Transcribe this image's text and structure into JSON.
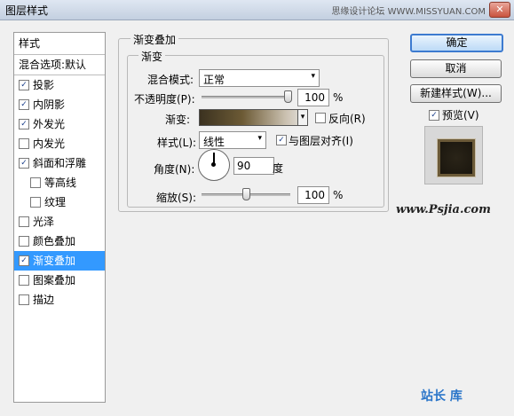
{
  "window": {
    "title": "图层样式",
    "watermark": "思缘设计论坛 WWW.MISSYUAN.COM",
    "close_glyph": "✕"
  },
  "styles_panel": {
    "header": "样式",
    "blend_default": "混合选项:默认",
    "items": [
      {
        "label": "投影",
        "checked": true,
        "sub": false,
        "selected": false
      },
      {
        "label": "内阴影",
        "checked": true,
        "sub": false,
        "selected": false
      },
      {
        "label": "外发光",
        "checked": true,
        "sub": false,
        "selected": false
      },
      {
        "label": "内发光",
        "checked": false,
        "sub": false,
        "selected": false
      },
      {
        "label": "斜面和浮雕",
        "checked": true,
        "sub": false,
        "selected": false
      },
      {
        "label": "等高线",
        "checked": false,
        "sub": true,
        "selected": false
      },
      {
        "label": "纹理",
        "checked": false,
        "sub": true,
        "selected": false
      },
      {
        "label": "光泽",
        "checked": false,
        "sub": false,
        "selected": false
      },
      {
        "label": "颜色叠加",
        "checked": false,
        "sub": false,
        "selected": false
      },
      {
        "label": "渐变叠加",
        "checked": true,
        "sub": false,
        "selected": true
      },
      {
        "label": "图案叠加",
        "checked": false,
        "sub": false,
        "selected": false
      },
      {
        "label": "描边",
        "checked": false,
        "sub": false,
        "selected": false
      }
    ]
  },
  "gradient_overlay": {
    "section_title": "渐变叠加",
    "group_title": "渐变",
    "blend_mode_label": "混合模式:",
    "blend_mode_value": "正常",
    "opacity_label": "不透明度(P):",
    "opacity_value": "100",
    "opacity_unit": "%",
    "opacity_fraction": 1.0,
    "gradient_label": "渐变:",
    "reverse_label": "反向(R)",
    "reverse_checked": false,
    "style_label": "样式(L):",
    "style_value": "线性",
    "align_label": "与图层对齐(I)",
    "align_checked": true,
    "angle_label": "角度(N):",
    "angle_value": "90",
    "angle_unit": "度",
    "scale_label": "缩放(S):",
    "scale_value": "100",
    "scale_unit": "%",
    "scale_fraction": 0.5
  },
  "buttons": {
    "ok": "确定",
    "cancel": "取消",
    "new_style": "新建样式(W)...",
    "preview_label": "预览(V)",
    "preview_checked": true
  },
  "footer": {
    "site_text": "www.Psjia.com",
    "logo_text": "站长 库"
  },
  "icons": {
    "check": "✓",
    "dropdown": "▾"
  }
}
